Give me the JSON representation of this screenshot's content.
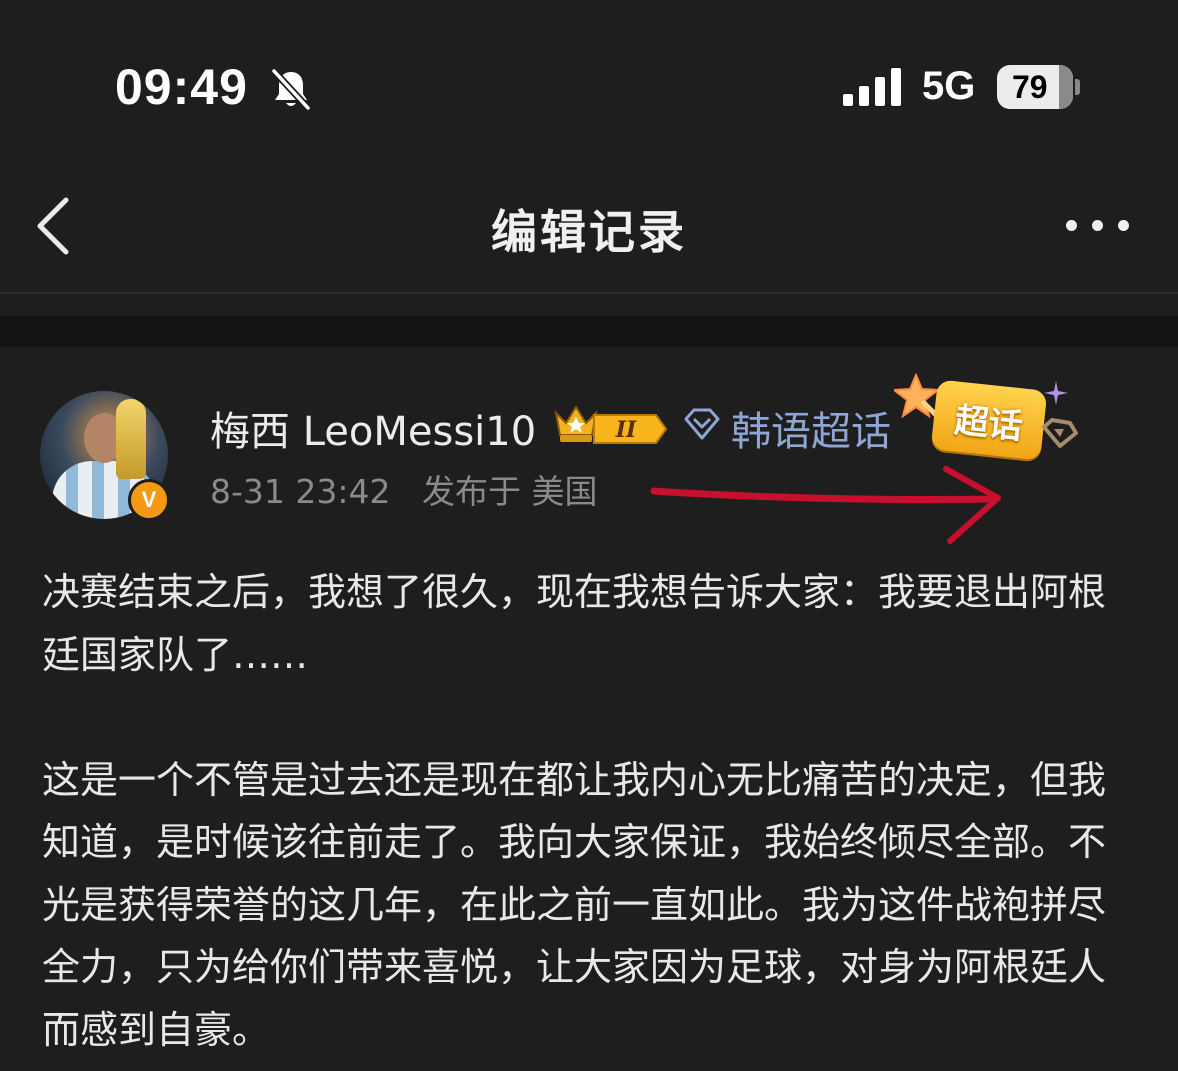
{
  "status_bar": {
    "time": "09:49",
    "network": "5G",
    "battery": "79"
  },
  "nav": {
    "title": "编辑记录"
  },
  "post": {
    "author": "梅西 LeoMessi10",
    "verified_badge": "V",
    "level_badge": "II",
    "topic": "韩语超话",
    "chaohua_label": "超话",
    "date": "8-31 23:42",
    "location": "发布于 美国",
    "paragraphs": [
      "决赛结束之后，我想了很久，现在我想告诉大家：我要退出阿根廷国家队了……",
      "这是一个不管是过去还是现在都让我内心无比痛苦的决定，但我知道，是时候该往前走了。我向大家保证，我始终倾尽全部。不光是获得荣誉的这几年，在此之前一直如此。我为这件战袍拼尽全力，只为给你们带来喜悦，让大家因为足球，对身为阿根廷人而感到自豪。"
    ]
  },
  "colors": {
    "background": "#1e1e1e",
    "topic_link": "#8fa6d4",
    "meta_text": "#8a8a8a",
    "verified_badge": "#f39a12",
    "annotation_arrow": "#c8102e"
  }
}
